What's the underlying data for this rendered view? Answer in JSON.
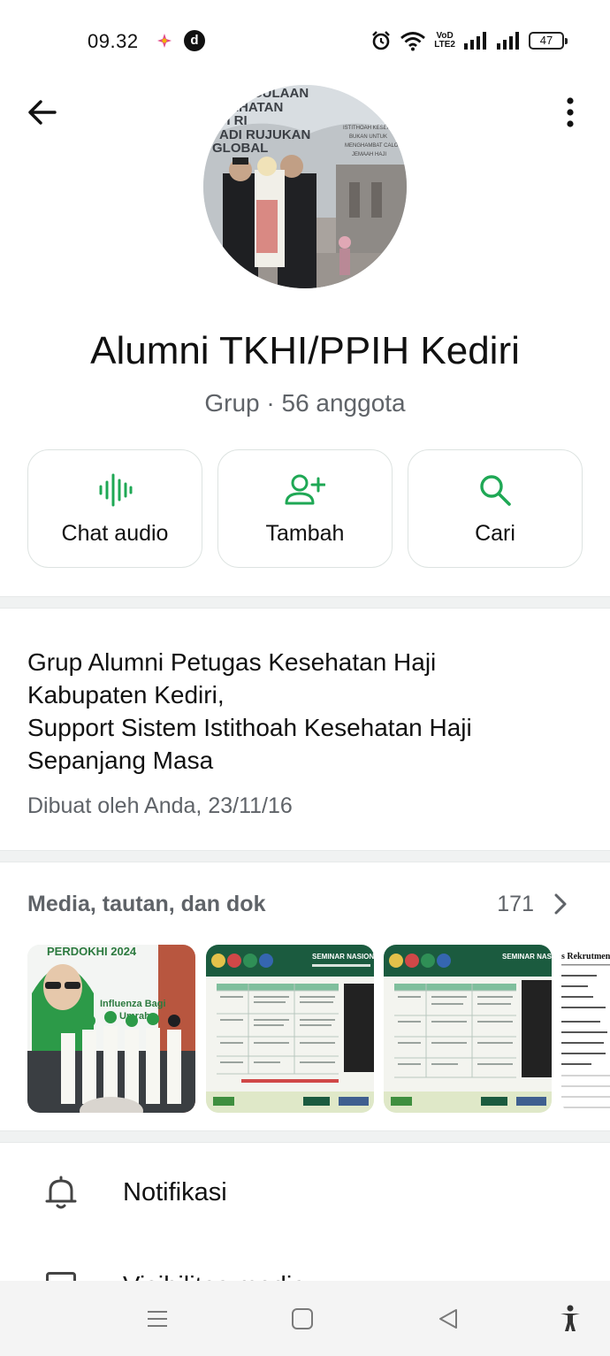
{
  "status_bar": {
    "time": "09.32",
    "app_badge": "d",
    "network_label_top": "VoD",
    "network_label_bottom": "LTE2",
    "battery": "47"
  },
  "header": {
    "back_icon": "arrow-left-icon",
    "more_icon": "more-vert-icon"
  },
  "group": {
    "name": "Alumni TKHI/PPIH Kediri",
    "subtitle": "Grup · 56 anggota"
  },
  "actions": [
    {
      "label": "Chat audio",
      "icon": "audio-wave-icon"
    },
    {
      "label": "Tambah",
      "icon": "person-add-icon"
    },
    {
      "label": "Cari",
      "icon": "search-icon"
    }
  ],
  "description": {
    "lines": [
      "Grup Alumni Petugas Kesehatan Haji",
      "Kabupaten Kediri,",
      "Support Sistem Istithoah Kesehatan Haji",
      "Sepanjang Masa"
    ],
    "created": "Dibuat oleh Anda, 23/11/16"
  },
  "media": {
    "title": "Media, tautan, dan dok",
    "count": "171",
    "thumbnails": [
      {
        "name": "photo-event",
        "caption_1": "PERDOKHI 2024",
        "caption_2": "Influenza Bagi",
        "caption_3": "Umrah"
      },
      {
        "name": "seminar-slide-1",
        "caption_1": "SEMINAR NASIONAL"
      },
      {
        "name": "seminar-slide-2",
        "caption_1": "SEMINAR NASIONAL"
      },
      {
        "name": "document-page",
        "caption_1": "s Rekrutmen"
      }
    ]
  },
  "settings": {
    "notifications_label": "Notifikasi",
    "visibility_label": "Visibilitas media"
  },
  "colors": {
    "accent": "#1fa855",
    "text_secondary": "#5f6368",
    "divider": "#f0f2f2"
  }
}
